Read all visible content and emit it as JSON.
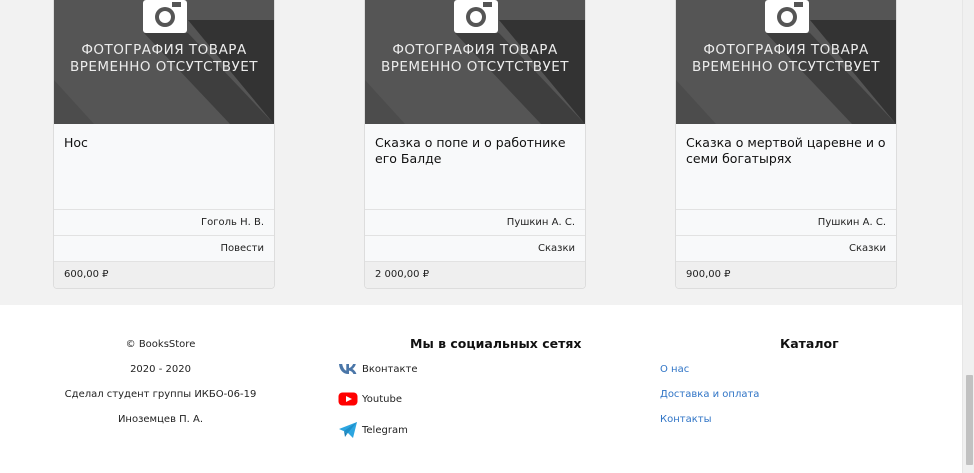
{
  "products": [
    {
      "placeholder_line1": "ФОТОГРАФИЯ ТОВАРА",
      "placeholder_line2": "ВРЕМЕННО ОТСУТСТВУЕТ",
      "title": "Нос",
      "author": "Гоголь Н. В.",
      "genre": "Повести",
      "price": "600,00 ₽"
    },
    {
      "placeholder_line1": "ФОТОГРАФИЯ ТОВАРА",
      "placeholder_line2": "ВРЕМЕННО ОТСУТСТВУЕТ",
      "title": "Сказка о попе и о работнике его Балде",
      "author": "Пушкин А. С.",
      "genre": "Сказки",
      "price": "2 000,00 ₽"
    },
    {
      "placeholder_line1": "ФОТОГРАФИЯ ТОВАРА",
      "placeholder_line2": "ВРЕМЕННО ОТСУТСТВУЕТ",
      "title": "Сказка о мертвой царевне и о семи богатырях",
      "author": "Пушкин А. С.",
      "genre": "Сказки",
      "price": "900,00 ₽"
    }
  ],
  "footer": {
    "copyright": "© BooksStore",
    "years": "2020 - 2020",
    "made_by": "Сделал студент группы ИКБО-06-19",
    "author": "Иноземцев П. А.",
    "social_heading": "Мы в социальных сетях",
    "social": [
      {
        "label": "Вконтакте",
        "icon": "vk-icon",
        "color": "#4a76a8"
      },
      {
        "label": "Youtube",
        "icon": "youtube-icon",
        "color": "#ff0000"
      },
      {
        "label": "Telegram",
        "icon": "telegram-icon",
        "color": "#2ca5e0"
      }
    ],
    "catalog_heading": "Каталог",
    "catalog_links": [
      "О нас",
      "Доставка и оплата",
      "Контакты"
    ]
  },
  "colors": {
    "link": "#2f74c6",
    "page_bg": "#f2f2f2",
    "card_bg": "#f8f9fa"
  }
}
